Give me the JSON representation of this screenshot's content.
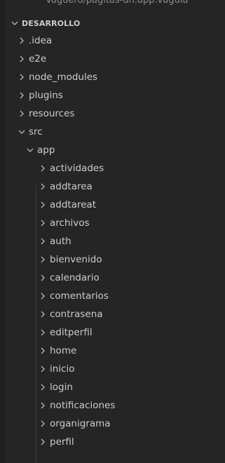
{
  "cut_header": "Vaguero/pagitas-dh.app.vaguia",
  "section": {
    "title": "DESARROLLO"
  },
  "tree": {
    "root_items": [
      {
        "label": ".idea",
        "expanded": false
      },
      {
        "label": "e2e",
        "expanded": false
      },
      {
        "label": "node_modules",
        "expanded": false
      },
      {
        "label": "plugins",
        "expanded": false
      },
      {
        "label": "resources",
        "expanded": false
      },
      {
        "label": "src",
        "expanded": true
      }
    ],
    "src_items": [
      {
        "label": "app",
        "expanded": true
      }
    ],
    "app_items": [
      {
        "label": "actividades"
      },
      {
        "label": "addtarea"
      },
      {
        "label": "addtareat"
      },
      {
        "label": "archivos"
      },
      {
        "label": "auth"
      },
      {
        "label": "bienvenido"
      },
      {
        "label": "calendario"
      },
      {
        "label": "comentarios"
      },
      {
        "label": "contrasena"
      },
      {
        "label": "editperfil"
      },
      {
        "label": "home"
      },
      {
        "label": "inicio"
      },
      {
        "label": "login"
      },
      {
        "label": "notificaciones"
      },
      {
        "label": "organigrama"
      },
      {
        "label": "perfil"
      }
    ]
  },
  "colors": {
    "background": "#252526",
    "text": "#cccccc",
    "indent_guide": "#3c3c3c"
  },
  "icons": {
    "collapsed": "chevron-right-icon",
    "expanded": "chevron-down-icon"
  }
}
